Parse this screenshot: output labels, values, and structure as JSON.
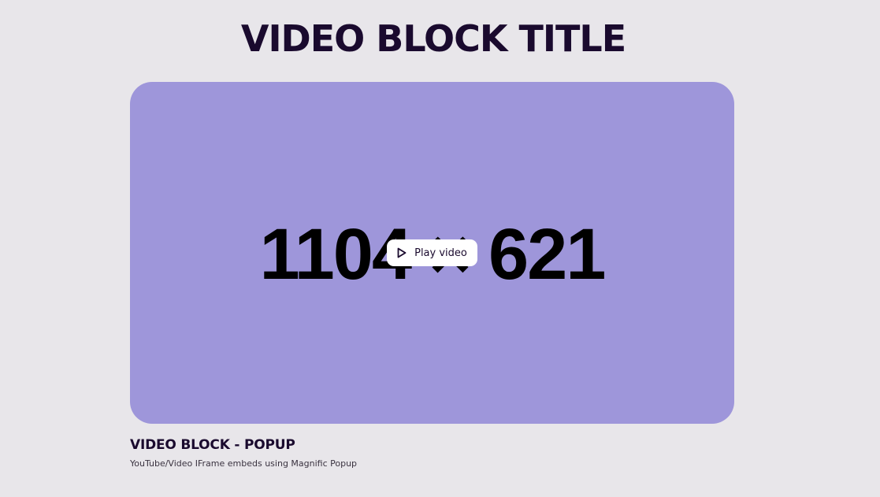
{
  "page": {
    "title": "VIDEO BLOCK TITLE"
  },
  "video": {
    "placeholder_text": "1104 × 621",
    "play_label": "Play video",
    "background_color": "#9e96da"
  },
  "caption": {
    "title": "VIDEO BLOCK - POPUP",
    "subtitle": "YouTube/Video IFrame embeds using Magnific Popup"
  },
  "colors": {
    "page_background": "#e8e6ea",
    "heading": "#1a0a2e",
    "button_background": "#ffffff"
  },
  "icons": {
    "play": "play-triangle-outline"
  }
}
